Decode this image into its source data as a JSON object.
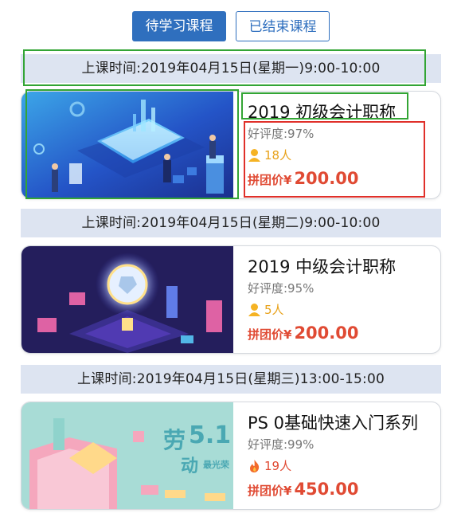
{
  "tabs": {
    "active": "待学习课程",
    "inactive": "已结束课程"
  },
  "courses": [
    {
      "time": "上课时间:2019年04月15日(星期一)9:00-10:00",
      "title": "2019 初级会计职称",
      "rating": "好评度:97%",
      "students": "18人",
      "student_icon": "person-icon",
      "price_label": "拼团价¥",
      "price": "200.00"
    },
    {
      "time": "上课时间:2019年04月15日(星期二)9:00-10:00",
      "title": "2019 中级会计职称",
      "rating": "好评度:95%",
      "students": "5人",
      "student_icon": "person-icon",
      "price_label": "拼团价¥",
      "price": "200.00"
    },
    {
      "time": "上课时间:2019年04月15日(星期三)13:00-15:00",
      "title": "PS 0基础快速入门系列",
      "rating": "好评度:99%",
      "students": "19人",
      "student_icon": "flame-icon",
      "price_label": "拼团价¥",
      "price": "450.00",
      "banner_big": "劳",
      "banner_big2": "动",
      "banner_num": "5.1",
      "banner_small": "最光荣"
    }
  ],
  "colors": {
    "primary": "#2f6fbe",
    "time_bar_bg": "#dde4f1",
    "price": "#e04a33",
    "students": "#e8a21a",
    "highlight_green": "#33a535",
    "highlight_red": "#e0302a"
  }
}
